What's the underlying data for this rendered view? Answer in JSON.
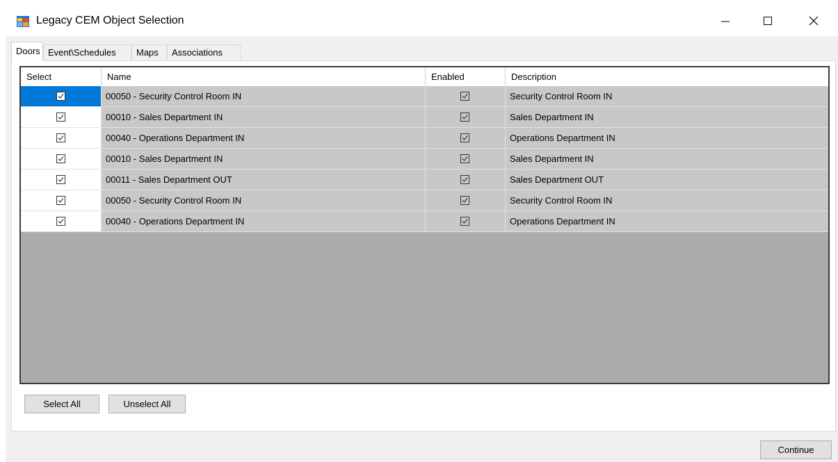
{
  "window": {
    "title": "Legacy CEM Object Selection",
    "app_icon": "app-window-icon",
    "controls": [
      "minimize-icon",
      "maximize-icon",
      "close-icon"
    ]
  },
  "tabs": [
    {
      "label": "Doors",
      "active": true
    },
    {
      "label": "Event\\Schedules",
      "active": false
    },
    {
      "label": "Maps",
      "active": false
    },
    {
      "label": "Associations",
      "active": false
    }
  ],
  "grid": {
    "columns": [
      "Select",
      "Name",
      "Enabled",
      "Description"
    ],
    "rows": [
      {
        "selected": true,
        "name": "00050 - Security Control Room IN",
        "enabled": true,
        "description": "Security Control Room IN"
      },
      {
        "selected": true,
        "name": "00010 - Sales Department IN",
        "enabled": true,
        "description": "Sales Department IN"
      },
      {
        "selected": true,
        "name": "00040 - Operations Department IN",
        "enabled": true,
        "description": "Operations Department IN"
      },
      {
        "selected": true,
        "name": "00010 - Sales Department IN",
        "enabled": true,
        "description": "Sales Department IN"
      },
      {
        "selected": true,
        "name": "00011 - Sales Department OUT",
        "enabled": true,
        "description": "Sales Department OUT"
      },
      {
        "selected": true,
        "name": "00050 - Security Control Room IN",
        "enabled": true,
        "description": "Security Control Room IN"
      },
      {
        "selected": true,
        "name": "00040 - Operations Department IN",
        "enabled": true,
        "description": "Operations Department IN"
      }
    ]
  },
  "buttons": {
    "select_all": "Select All",
    "unselect_all": "Unselect All",
    "continue": "Continue"
  },
  "colors": {
    "current_cell": "#0078d7",
    "row_background": "#c8c8c8",
    "grid_empty_area": "#ababab"
  }
}
